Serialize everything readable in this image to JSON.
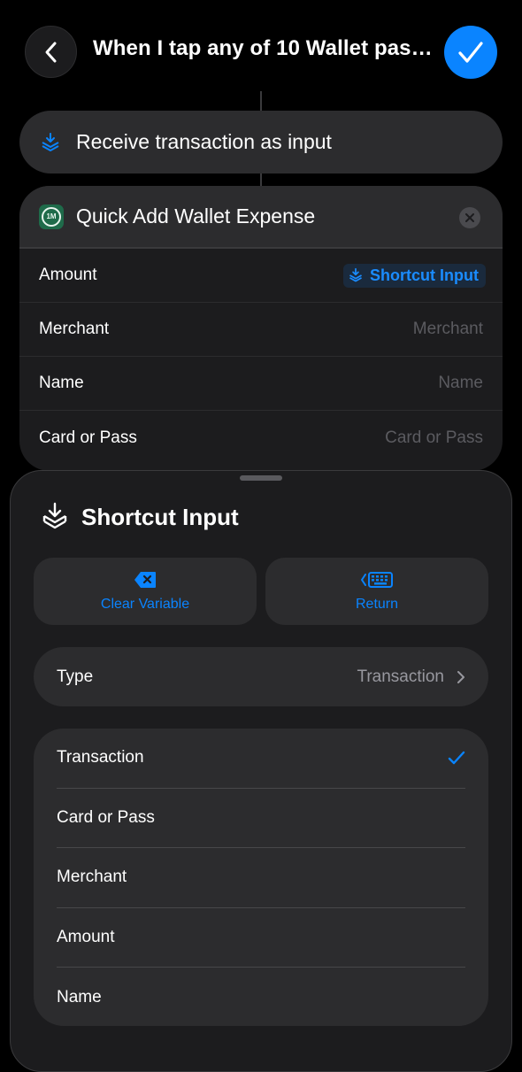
{
  "header": {
    "title": "When I tap any of 10 Wallet pass…",
    "accent": "#0a84ff"
  },
  "trigger": {
    "label": "Receive transaction as input",
    "icon": "shortcut-input-icon"
  },
  "action": {
    "title": "Quick Add Wallet Expense",
    "app_icon_text": "1M",
    "params": [
      {
        "label": "Amount",
        "variable": "Shortcut Input"
      },
      {
        "label": "Merchant",
        "placeholder": "Merchant"
      },
      {
        "label": "Name",
        "placeholder": "Name"
      },
      {
        "label": "Card or Pass",
        "placeholder": "Card or Pass"
      }
    ]
  },
  "sheet": {
    "title": "Shortcut Input",
    "buttons": {
      "clear_label": "Clear Variable",
      "return_label": "Return"
    },
    "type_row": {
      "label": "Type",
      "value": "Transaction"
    },
    "options": [
      {
        "label": "Transaction",
        "selected": true
      },
      {
        "label": "Card or Pass",
        "selected": false
      },
      {
        "label": "Merchant",
        "selected": false
      },
      {
        "label": "Amount",
        "selected": false
      },
      {
        "label": "Name",
        "selected": false
      }
    ]
  }
}
